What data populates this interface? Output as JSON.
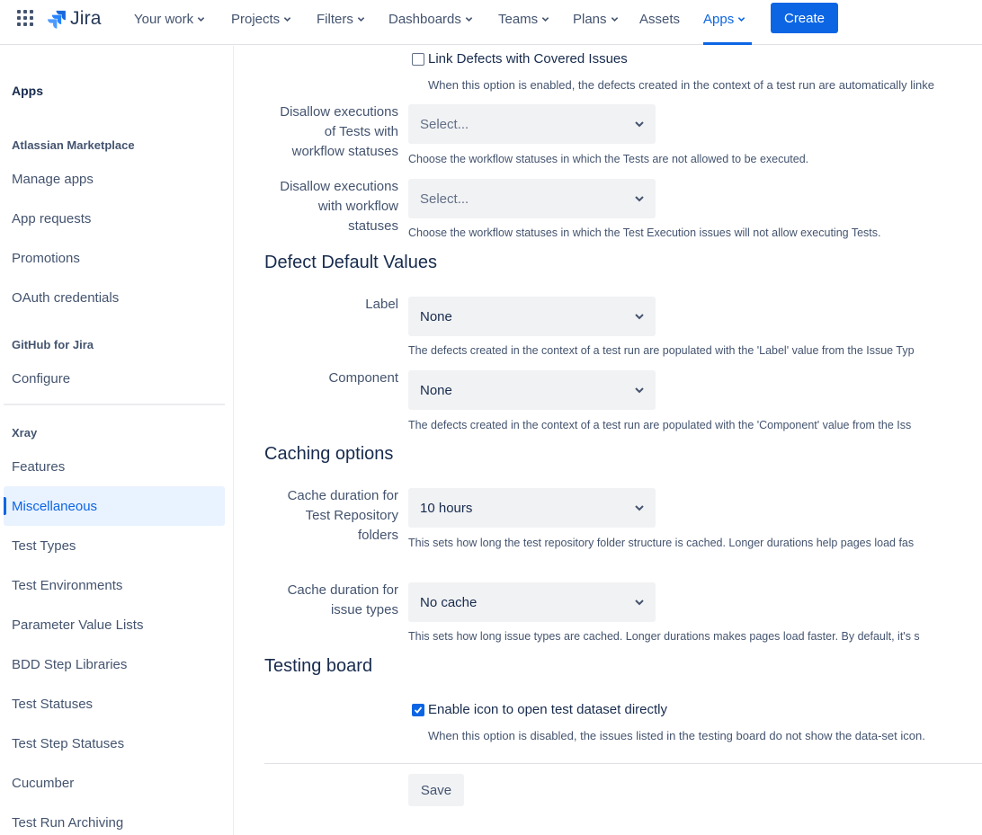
{
  "topnav": {
    "logo_text": "Jira",
    "items": [
      {
        "label": "Your work"
      },
      {
        "label": "Projects"
      },
      {
        "label": "Filters"
      },
      {
        "label": "Dashboards"
      },
      {
        "label": "Teams"
      },
      {
        "label": "Plans"
      },
      {
        "label": "Assets"
      },
      {
        "label": "Apps"
      }
    ],
    "active_item": "Apps",
    "create_label": "Create",
    "accent": "#0c66e4"
  },
  "sidebar": {
    "title": "Apps",
    "groups": [
      {
        "heading": "Atlassian Marketplace",
        "items": [
          "Manage apps",
          "App requests",
          "Promotions",
          "OAuth credentials"
        ]
      },
      {
        "heading": "GitHub for Jira",
        "items": [
          "Configure"
        ]
      },
      {
        "heading": "Xray",
        "items": [
          "Features",
          "Miscellaneous",
          "Test Types",
          "Test Environments",
          "Parameter Value Lists",
          "BDD Step Libraries",
          "Test Statuses",
          "Test Step Statuses",
          "Cucumber",
          "Test Run Archiving"
        ]
      }
    ],
    "selected": "Miscellaneous"
  },
  "main": {
    "link_defects": {
      "checked": false,
      "label": "Link Defects with Covered Issues",
      "help": "When this option is enabled, the defects created in the context of a test run are automatically linke"
    },
    "disallow_tests": {
      "label_lines": [
        "Disallow executions",
        "of Tests with",
        "workflow statuses"
      ],
      "value": "Select...",
      "help": "Choose the workflow statuses in which the Tests are not allowed to be executed."
    },
    "disallow_workflow": {
      "label_lines": [
        "Disallow executions",
        "with workflow",
        "statuses"
      ],
      "value": "Select...",
      "help": "Choose the workflow statuses in which the Test Execution issues will not allow executing Tests."
    },
    "defect_section": "Defect Default Values",
    "label_field": {
      "label": "Label",
      "value": "None",
      "help": "The defects created in the context of a test run are populated with the 'Label' value from the Issue Typ"
    },
    "component_field": {
      "label": "Component",
      "value": "None",
      "help": "The defects created in the context of a test run are populated with the 'Component' value from the Iss"
    },
    "caching_section": "Caching options",
    "cache_repo": {
      "label_lines": [
        "Cache duration for",
        "Test Repository",
        "folders"
      ],
      "value": "10 hours",
      "help": "This sets how long the test repository folder structure is cached. Longer durations help pages load fas"
    },
    "cache_issue_types": {
      "label_lines": [
        "Cache duration for",
        "issue types"
      ],
      "value": "No cache",
      "help": "This sets how long issue types are cached. Longer durations makes pages load faster. By default, it's s"
    },
    "testing_section": "Testing board",
    "dataset_icon": {
      "checked": true,
      "label": "Enable icon to open test dataset directly",
      "help": "When this option is disabled, the issues listed in the testing board do not show the data-set icon."
    },
    "save_label": "Save"
  }
}
